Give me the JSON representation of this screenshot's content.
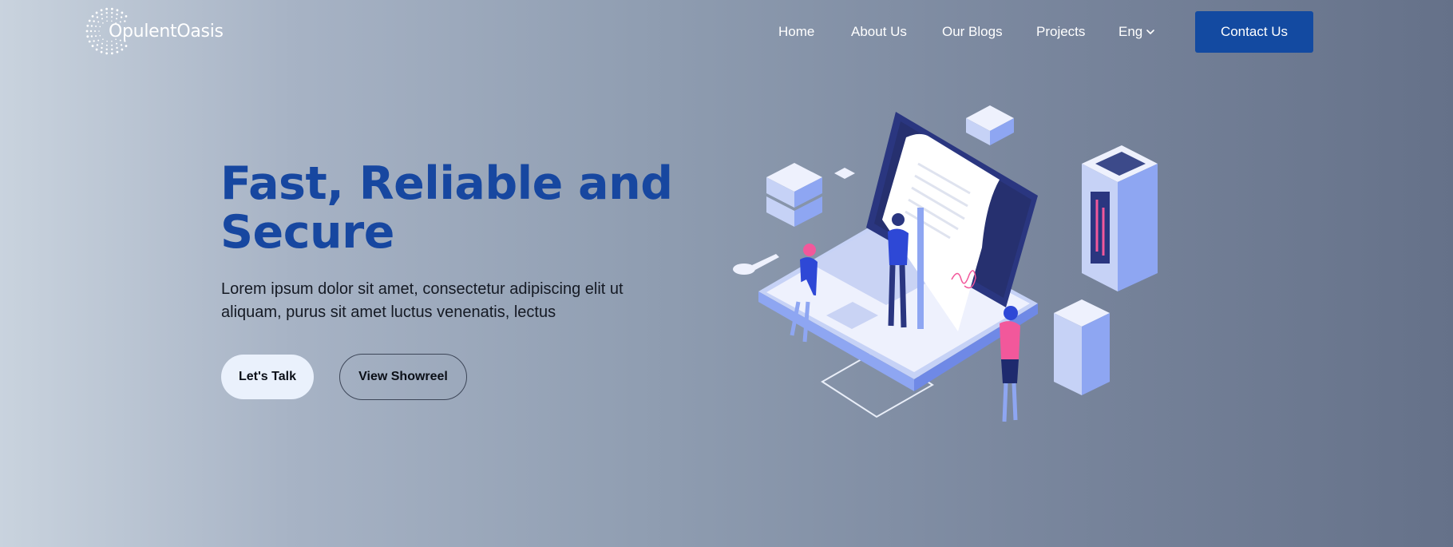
{
  "brand": {
    "name": "OpulentOasis"
  },
  "nav": {
    "items": [
      {
        "label": "Home"
      },
      {
        "label": "About Us"
      },
      {
        "label": "Our Blogs"
      },
      {
        "label": "Projects"
      }
    ],
    "language": {
      "label": "Eng",
      "icon": "chevron-down-icon"
    },
    "contact_label": "Contact Us"
  },
  "hero": {
    "title": "Fast, Reliable and Secure",
    "description": "Lorem ipsum dolor sit amet, consectetur adipiscing elit ut aliquam, purus sit amet luctus venenatis, lectus",
    "primary_button": "Let's Talk",
    "secondary_button": "View Showreel"
  },
  "illustration": {
    "icon": "laptop-document-signing-illustration"
  },
  "colors": {
    "accent": "#134aa1",
    "title": "#1747a0",
    "pink": "#f2589b",
    "indigo": "#2b3a8f",
    "periwinkle": "#8fa6f5"
  }
}
